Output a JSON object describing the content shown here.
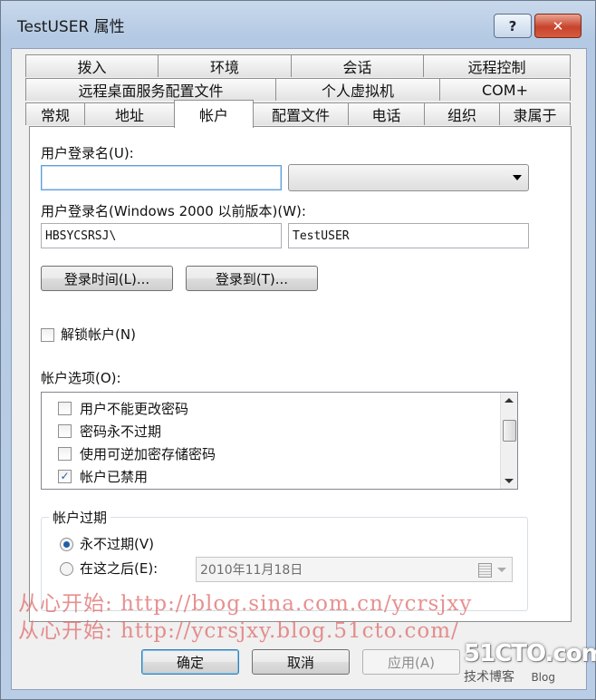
{
  "window": {
    "title": "TestUSER 属性",
    "help_glyph": "?",
    "close_glyph": "✕"
  },
  "tabs": {
    "row1": [
      "拨入",
      "环境",
      "会话",
      "远程控制"
    ],
    "row2": [
      "远程桌面服务配置文件",
      "个人虚拟机",
      "COM+"
    ],
    "row3": [
      "常规",
      "地址",
      "帐户",
      "配置文件",
      "电话",
      "组织",
      "隶属于"
    ],
    "active": "帐户"
  },
  "account": {
    "logon_label": "用户登录名(U):",
    "logon_value": "",
    "suffix_value": "",
    "pre2000_label": "用户登录名(Windows 2000 以前版本)(W):",
    "domain_value": "HBSYCSRSJ\\",
    "username_value": "TestUSER",
    "logon_hours_button": "登录时间(L)...",
    "logon_to_button": "登录到(T)...",
    "unlock_label": "解锁帐户(N)",
    "options_label": "帐户选项(O):",
    "options": [
      {
        "label": "用户不能更改密码",
        "checked": false
      },
      {
        "label": "密码永不过期",
        "checked": false
      },
      {
        "label": "使用可逆加密存储密码",
        "checked": false
      },
      {
        "label": "帐户已禁用",
        "checked": true
      }
    ],
    "expiry_group": "帐户过期",
    "never_label": "永不过期(V)",
    "after_label": "在这之后(E):",
    "expiry_date": "2010年11月18日",
    "check_glyph": "✓"
  },
  "footer": {
    "ok": "确定",
    "cancel": "取消",
    "apply": "应用(A)"
  },
  "watermark": {
    "line1": "从心开始: http://blog.sina.com.cn/ycrsjxy",
    "line2": "从心开始: http://ycrsjxy.blog.51cto.com/"
  },
  "logo": {
    "top": "51CTO.com",
    "bottom": "技术博客",
    "tag": "Blog"
  }
}
